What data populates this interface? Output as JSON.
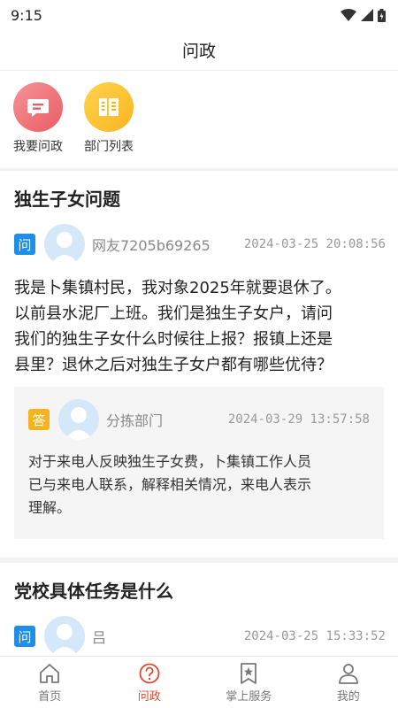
{
  "status": {
    "time": "9:15"
  },
  "header": {
    "title": "问政"
  },
  "quick_actions": [
    {
      "label": "我要问政",
      "icon": "message-icon"
    },
    {
      "label": "部门列表",
      "icon": "list-icon"
    }
  ],
  "posts": [
    {
      "title": "独生子女问题",
      "question_tag": "问",
      "author": "网友7205b69265",
      "time": "2024-03-25 20:08:56",
      "content_lines": [
        "我是卜集镇村民，我对象2025年就要退休了。",
        "以前县水泥厂上班。我们是独生子女户，请问",
        "我们的独生子女什么时候往上报？报镇上还是",
        "县里？退休之后对独生子女户都有哪些优待？"
      ],
      "answer": {
        "tag": "答",
        "department": "分拣部门",
        "time": "2024-03-29 13:57:58",
        "content_lines": [
          "对于来电人反映独生子女费，卜集镇工作人员",
          "已与来电人联系，解释相关情况，来电人表示",
          "理解。"
        ]
      }
    },
    {
      "title": "党校具体任务是什么",
      "question_tag": "问",
      "author": "吕",
      "time": "2024-03-25 15:33:52"
    }
  ],
  "tabbar": [
    {
      "label": "首页",
      "icon": "home-icon",
      "active": false
    },
    {
      "label": "问政",
      "icon": "question-icon",
      "active": true
    },
    {
      "label": "掌上服务",
      "icon": "bookmark-star-icon",
      "active": false
    },
    {
      "label": "我的",
      "icon": "user-icon",
      "active": false
    }
  ],
  "colors": {
    "accent": "#d84b2f",
    "question_tag": "#1e8ee8",
    "answer_tag": "#f5b41e"
  }
}
